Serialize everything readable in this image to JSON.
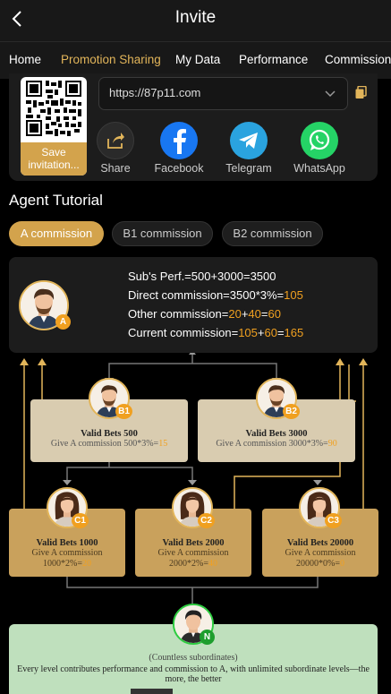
{
  "header": {
    "title": "Invite"
  },
  "tabs": [
    {
      "label": "Home",
      "active": false
    },
    {
      "label": "Promotion Sharing",
      "active": true
    },
    {
      "label": "My Data",
      "active": false
    },
    {
      "label": "Performance",
      "active": false
    },
    {
      "label": "Commission",
      "active": false
    }
  ],
  "share": {
    "save_label": "Save invitation...",
    "url": "https://87p11.com",
    "items": [
      {
        "label": "Share",
        "icon": "share-icon"
      },
      {
        "label": "Facebook",
        "icon": "facebook-icon"
      },
      {
        "label": "Telegram",
        "icon": "telegram-icon"
      },
      {
        "label": "WhatsApp",
        "icon": "whatsapp-icon"
      }
    ]
  },
  "tutorial": {
    "title": "Agent Tutorial",
    "pills": [
      {
        "label": "A commission",
        "active": true
      },
      {
        "label": "B1 commission",
        "active": false
      },
      {
        "label": "B2 commission",
        "active": false
      }
    ],
    "formula": {
      "line1": "Sub's Perf.=500+3000=3500",
      "line2_prefix": "Direct commission=3500*3%=",
      "line2_value": "105",
      "line3_prefix": "Other commission=",
      "line3_a": "20",
      "line3_plus1": "+",
      "line3_b": "40",
      "line3_eq": "=",
      "line3_total": "60",
      "line4_prefix": "Current commission=",
      "line4_a": "105",
      "line4_plus": "+",
      "line4_b": "60",
      "line4_eq": "=",
      "line4_total": "165"
    },
    "badges": {
      "a": "A",
      "b1": "B1",
      "b2": "B2",
      "c1": "C1",
      "c2": "C2",
      "c3": "C3",
      "n": "N"
    },
    "b_level": [
      {
        "title": "Valid Bets 500",
        "sub_prefix": "Give A commission 500*3%=",
        "sub_value": "15"
      },
      {
        "title": "Valid Bets 3000",
        "sub_prefix": "Give A commission 3000*3%=",
        "sub_value": "90"
      }
    ],
    "c_level": [
      {
        "title": "Valid Bets 1000",
        "sub1": "Give A commission",
        "sub2_prefix": "1000*2%=",
        "sub2_value": "20"
      },
      {
        "title": "Valid Bets 2000",
        "sub1": "Give A commission",
        "sub2_prefix": "2000*2%=",
        "sub2_value": "40"
      },
      {
        "title": "Valid Bets 20000",
        "sub1": "Give A commission",
        "sub2_prefix": "20000*0%=",
        "sub2_value": "0"
      }
    ],
    "bottom": {
      "sub": "(Countless subordinates)",
      "desc": "Every level contributes performance and commission to A, with unlimited subordinate levels—the more, the better"
    }
  },
  "colors": {
    "accent": "#d3a34c",
    "gold_text": "#f0a020",
    "orange_arrow": "#f0a020",
    "green_card": "#bfe0bd"
  }
}
